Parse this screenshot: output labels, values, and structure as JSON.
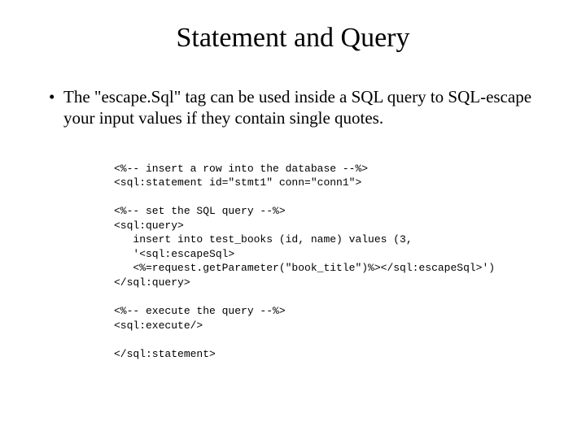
{
  "title": "Statement and Query",
  "bullet": {
    "dot": "•",
    "text": "The \"escape.Sql\" tag can be used inside a SQL query to SQL-escape your input values if they contain single quotes."
  },
  "code": {
    "l1": "<%-- insert a row into the database --%>",
    "l2": "<sql:statement id=\"stmt1\" conn=\"conn1\">",
    "l3": "",
    "l4": "<%-- set the SQL query --%>",
    "l5": "<sql:query>",
    "l6": "   insert into test_books (id, name) values (3,",
    "l7": "   '<sql:escapeSql>",
    "l8": "   <%=request.getParameter(\"book_title\")%></sql:escapeSql>')",
    "l9": "</sql:query>",
    "l10": "",
    "l11": "<%-- execute the query --%>",
    "l12": "<sql:execute/>",
    "l13": "",
    "l14": "</sql:statement>"
  }
}
